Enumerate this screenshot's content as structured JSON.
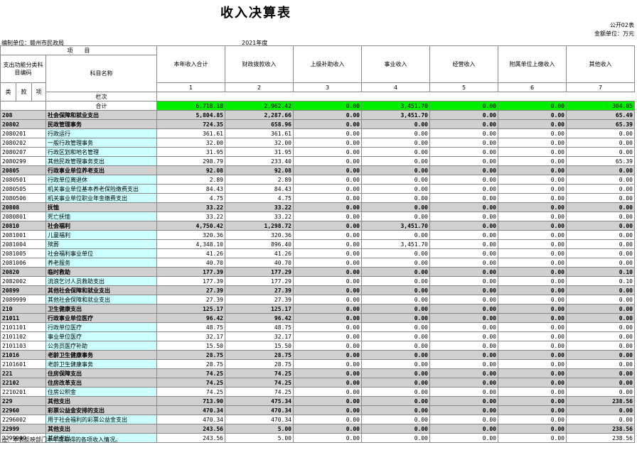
{
  "title": "收入决算表",
  "form_no": "公开02表",
  "unit_label": "金额单位：万元",
  "org": "编制单位：赣州市民政局",
  "year": "2021年度",
  "header": {
    "item_label": "项　　目",
    "code_group": "支出功能分类科目编码",
    "name": "科目名称",
    "cols": [
      "本年收入合计",
      "财政拨款收入",
      "上级补助收入",
      "事业收入",
      "经营收入",
      "附属单位上缴收入",
      "其他收入"
    ],
    "lei": "类",
    "kuan": "款",
    "xiang": "项",
    "row_no": "栏次",
    "col_nums": [
      "1",
      "2",
      "3",
      "4",
      "5",
      "6",
      "7"
    ]
  },
  "total": {
    "label": "合计",
    "vals": [
      "6,718.18",
      "2,962.42",
      "0.00",
      "3,451.70",
      "0.00",
      "0.00",
      "304.05"
    ]
  },
  "rows": [
    {
      "code": "208",
      "name": "社会保障和就业支出",
      "bold": true,
      "vals": [
        "5,804.85",
        "2,287.66",
        "0.00",
        "3,451.70",
        "0.00",
        "0.00",
        "65.49"
      ]
    },
    {
      "code": "20802",
      "name": "民政管理事务",
      "bold": true,
      "vals": [
        "724.35",
        "658.96",
        "0.00",
        "0.00",
        "0.00",
        "0.00",
        "65.39"
      ]
    },
    {
      "code": "2080201",
      "name": "行政运行",
      "bold": false,
      "vals": [
        "361.61",
        "361.61",
        "0.00",
        "0.00",
        "0.00",
        "0.00",
        "0.00"
      ]
    },
    {
      "code": "2080202",
      "name": "一般行政管理事务",
      "bold": false,
      "vals": [
        "32.00",
        "32.00",
        "0.00",
        "0.00",
        "0.00",
        "0.00",
        "0.00"
      ]
    },
    {
      "code": "2080207",
      "name": "行政区划和地名管理",
      "bold": false,
      "vals": [
        "31.95",
        "31.95",
        "0.00",
        "0.00",
        "0.00",
        "0.00",
        "0.00"
      ]
    },
    {
      "code": "2080299",
      "name": "其他民政管理事务支出",
      "bold": false,
      "vals": [
        "298.79",
        "233.40",
        "0.00",
        "0.00",
        "0.00",
        "0.00",
        "65.39"
      ]
    },
    {
      "code": "20805",
      "name": "行政事业单位养老支出",
      "bold": true,
      "vals": [
        "92.08",
        "92.08",
        "0.00",
        "0.00",
        "0.00",
        "0.00",
        "0.00"
      ]
    },
    {
      "code": "2080501",
      "name": "行政单位离退休",
      "bold": false,
      "vals": [
        "2.89",
        "2.89",
        "0.00",
        "0.00",
        "0.00",
        "0.00",
        "0.00"
      ]
    },
    {
      "code": "2080505",
      "name": "机关事业单位基本养老保险缴费支出",
      "bold": false,
      "vals": [
        "84.43",
        "84.43",
        "0.00",
        "0.00",
        "0.00",
        "0.00",
        "0.00"
      ]
    },
    {
      "code": "2080506",
      "name": "机关事业单位职业年金缴费支出",
      "bold": false,
      "vals": [
        "4.75",
        "4.75",
        "0.00",
        "0.00",
        "0.00",
        "0.00",
        "0.00"
      ]
    },
    {
      "code": "20808",
      "name": "抚恤",
      "bold": true,
      "vals": [
        "33.22",
        "33.22",
        "0.00",
        "0.00",
        "0.00",
        "0.00",
        "0.00"
      ]
    },
    {
      "code": "2080801",
      "name": "死亡抚恤",
      "bold": false,
      "vals": [
        "33.22",
        "33.22",
        "0.00",
        "0.00",
        "0.00",
        "0.00",
        "0.00"
      ]
    },
    {
      "code": "20810",
      "name": "社会福利",
      "bold": true,
      "vals": [
        "4,750.42",
        "1,298.72",
        "0.00",
        "3,451.70",
        "0.00",
        "0.00",
        "0.00"
      ]
    },
    {
      "code": "2081001",
      "name": "儿童福利",
      "bold": false,
      "vals": [
        "320.36",
        "320.36",
        "0.00",
        "0.00",
        "0.00",
        "0.00",
        "0.00"
      ]
    },
    {
      "code": "2081004",
      "name": "殡葬",
      "bold": false,
      "vals": [
        "4,348.10",
        "896.40",
        "0.00",
        "3,451.70",
        "0.00",
        "0.00",
        "0.00"
      ]
    },
    {
      "code": "2081005",
      "name": "社会福利事业单位",
      "bold": false,
      "vals": [
        "41.26",
        "41.26",
        "0.00",
        "0.00",
        "0.00",
        "0.00",
        "0.00"
      ]
    },
    {
      "code": "2081006",
      "name": "养老服务",
      "bold": false,
      "vals": [
        "40.70",
        "40.70",
        "0.00",
        "0.00",
        "0.00",
        "0.00",
        "0.00"
      ]
    },
    {
      "code": "20820",
      "name": "临时救助",
      "bold": true,
      "vals": [
        "177.39",
        "177.29",
        "0.00",
        "0.00",
        "0.00",
        "0.00",
        "0.10"
      ]
    },
    {
      "code": "2082002",
      "name": "流浪乞讨人员救助支出",
      "bold": false,
      "vals": [
        "177.39",
        "177.29",
        "0.00",
        "0.00",
        "0.00",
        "0.00",
        "0.10"
      ]
    },
    {
      "code": "20899",
      "name": "其他社会保障和就业支出",
      "bold": true,
      "vals": [
        "27.39",
        "27.39",
        "0.00",
        "0.00",
        "0.00",
        "0.00",
        "0.00"
      ]
    },
    {
      "code": "2089999",
      "name": "其他社会保障和就业支出",
      "bold": false,
      "vals": [
        "27.39",
        "27.39",
        "0.00",
        "0.00",
        "0.00",
        "0.00",
        "0.00"
      ]
    },
    {
      "code": "210",
      "name": "卫生健康支出",
      "bold": true,
      "vals": [
        "125.17",
        "125.17",
        "0.00",
        "0.00",
        "0.00",
        "0.00",
        "0.00"
      ]
    },
    {
      "code": "21011",
      "name": "行政事业单位医疗",
      "bold": true,
      "vals": [
        "96.42",
        "96.42",
        "0.00",
        "0.00",
        "0.00",
        "0.00",
        "0.00"
      ]
    },
    {
      "code": "2101101",
      "name": "行政单位医疗",
      "bold": false,
      "vals": [
        "48.75",
        "48.75",
        "0.00",
        "0.00",
        "0.00",
        "0.00",
        "0.00"
      ]
    },
    {
      "code": "2101102",
      "name": "事业单位医疗",
      "bold": false,
      "vals": [
        "32.17",
        "32.17",
        "0.00",
        "0.00",
        "0.00",
        "0.00",
        "0.00"
      ]
    },
    {
      "code": "2101103",
      "name": "公务员医疗补助",
      "bold": false,
      "vals": [
        "15.50",
        "15.50",
        "0.00",
        "0.00",
        "0.00",
        "0.00",
        "0.00"
      ]
    },
    {
      "code": "21016",
      "name": "老龄卫生健康事务",
      "bold": true,
      "vals": [
        "28.75",
        "28.75",
        "0.00",
        "0.00",
        "0.00",
        "0.00",
        "0.00"
      ]
    },
    {
      "code": "2101601",
      "name": "老龄卫生健康事务",
      "bold": false,
      "vals": [
        "28.75",
        "28.75",
        "0.00",
        "0.00",
        "0.00",
        "0.00",
        "0.00"
      ]
    },
    {
      "code": "221",
      "name": "住房保障支出",
      "bold": true,
      "vals": [
        "74.25",
        "74.25",
        "0.00",
        "0.00",
        "0.00",
        "0.00",
        "0.00"
      ]
    },
    {
      "code": "22102",
      "name": "住房改革支出",
      "bold": true,
      "vals": [
        "74.25",
        "74.25",
        "0.00",
        "0.00",
        "0.00",
        "0.00",
        "0.00"
      ]
    },
    {
      "code": "2210201",
      "name": "住房公积金",
      "bold": false,
      "vals": [
        "74.25",
        "74.25",
        "0.00",
        "0.00",
        "0.00",
        "0.00",
        "0.00"
      ]
    },
    {
      "code": "229",
      "name": "其他支出",
      "bold": true,
      "vals": [
        "713.90",
        "475.34",
        "0.00",
        "0.00",
        "0.00",
        "0.00",
        "238.56"
      ]
    },
    {
      "code": "22960",
      "name": "彩票公益金安排的支出",
      "bold": true,
      "vals": [
        "470.34",
        "470.34",
        "0.00",
        "0.00",
        "0.00",
        "0.00",
        "0.00"
      ]
    },
    {
      "code": "2296002",
      "name": "用于社会福利的彩票公益金支出",
      "bold": false,
      "vals": [
        "470.34",
        "470.34",
        "0.00",
        "0.00",
        "0.00",
        "0.00",
        "0.00"
      ]
    },
    {
      "code": "22999",
      "name": "其他支出",
      "bold": true,
      "vals": [
        "243.56",
        "5.00",
        "0.00",
        "0.00",
        "0.00",
        "0.00",
        "238.56"
      ]
    },
    {
      "code": "2299999",
      "name": "其他支出",
      "bold": false,
      "vals": [
        "243.56",
        "5.00",
        "0.00",
        "0.00",
        "0.00",
        "0.00",
        "238.56"
      ]
    }
  ],
  "note": "注：本表反映部门本年度取得的各项收入情况。"
}
